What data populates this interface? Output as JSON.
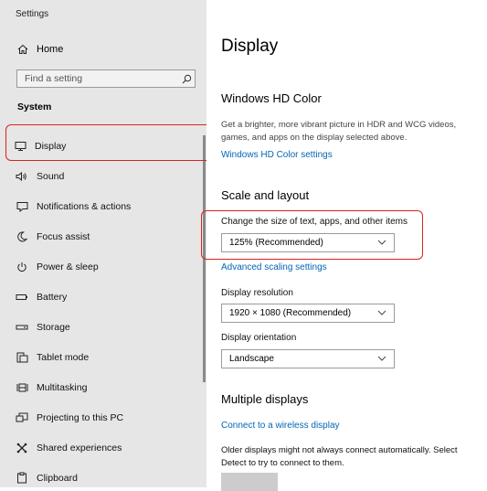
{
  "sidebar": {
    "app_title": "Settings",
    "home_label": "Home",
    "search_placeholder": "Find a setting",
    "section_title": "System",
    "items": [
      {
        "label": "Display",
        "icon": "monitor-icon"
      },
      {
        "label": "Sound",
        "icon": "speaker-icon"
      },
      {
        "label": "Notifications & actions",
        "icon": "notification-icon"
      },
      {
        "label": "Focus assist",
        "icon": "moon-icon"
      },
      {
        "label": "Power & sleep",
        "icon": "power-icon"
      },
      {
        "label": "Battery",
        "icon": "battery-icon"
      },
      {
        "label": "Storage",
        "icon": "storage-icon"
      },
      {
        "label": "Tablet mode",
        "icon": "tablet-mode-icon"
      },
      {
        "label": "Multitasking",
        "icon": "multitasking-icon"
      },
      {
        "label": "Projecting to this PC",
        "icon": "projecting-icon"
      },
      {
        "label": "Shared experiences",
        "icon": "shared-experiences-icon"
      },
      {
        "label": "Clipboard",
        "icon": "clipboard-icon"
      }
    ]
  },
  "main": {
    "title": "Display",
    "hd_color": {
      "heading": "Windows HD Color",
      "description_line1": "Get a brighter, more vibrant picture in HDR and WCG videos,",
      "description_line2": "games, and apps on the display selected above.",
      "link": "Windows HD Color settings"
    },
    "scale_layout": {
      "heading": "Scale and layout",
      "scale_label": "Change the size of text, apps, and other items",
      "scale_value": "125% (Recommended)",
      "advanced_link": "Advanced scaling settings",
      "resolution_label": "Display resolution",
      "resolution_value": "1920 × 1080 (Recommended)",
      "orientation_label": "Display orientation",
      "orientation_value": "Landscape"
    },
    "multiple_displays": {
      "heading": "Multiple displays",
      "link": "Connect to a wireless display",
      "note_line1": "Older displays might not always connect automatically. Select",
      "note_line2": "Detect to try to connect to them."
    }
  },
  "colors": {
    "sidebar_bg": "#e6e6e6",
    "link": "#0066b4",
    "highlight_box": "#d9231f"
  }
}
